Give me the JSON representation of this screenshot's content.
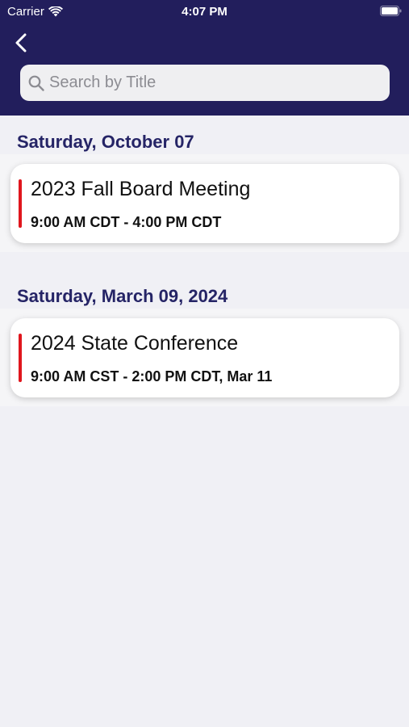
{
  "status_bar": {
    "carrier": "Carrier",
    "time": "4:07 PM"
  },
  "icons": {
    "back": "chevron-left-icon",
    "search": "magnifier-icon",
    "wifi": "wifi-icon",
    "battery": "battery-icon"
  },
  "colors": {
    "header_bg": "#221e5c",
    "section_title": "#252466",
    "accent": "#e0161d"
  },
  "search": {
    "placeholder": "Search by Title",
    "value": ""
  },
  "sections": [
    {
      "date": "Saturday, October 07",
      "events": [
        {
          "title": "2023 Fall Board Meeting",
          "time": "9:00 AM CDT - 4:00 PM CDT",
          "accent_color": "#e0161d"
        }
      ]
    },
    {
      "date": "Saturday, March 09, 2024",
      "events": [
        {
          "title": "2024 State Conference",
          "time": "9:00 AM CST - 2:00 PM CDT, Mar 11",
          "accent_color": "#e0161d"
        }
      ]
    }
  ]
}
